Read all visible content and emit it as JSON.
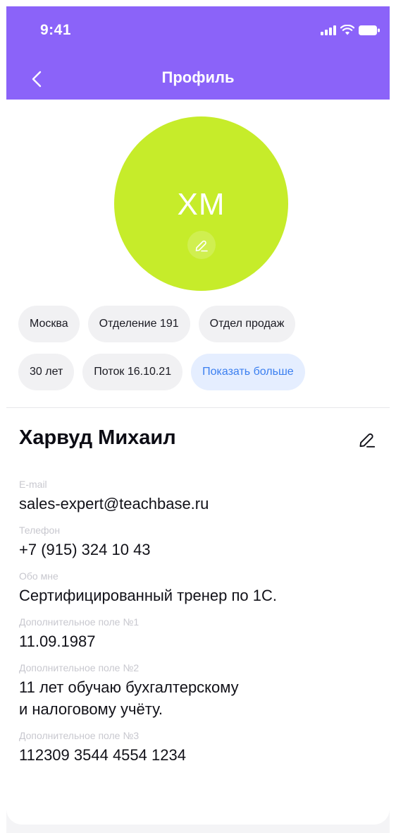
{
  "status_bar": {
    "time": "9:41"
  },
  "header": {
    "title": "Профиль"
  },
  "profile": {
    "initials": "ХМ",
    "name": "Харвуд Михаил"
  },
  "tags": {
    "row1": [
      "Москва",
      "Отделение 191",
      "Отдел продаж"
    ],
    "row2": [
      "30 лет",
      "Поток 16.10.21"
    ],
    "show_more": "Показать больше"
  },
  "fields": [
    {
      "label": "E-mail",
      "value": "sales-expert@teachbase.ru"
    },
    {
      "label": "Телефон",
      "value": "+7 (915) 324 10 43"
    },
    {
      "label": "Обо мне",
      "value": "Сертифицированный тренер по 1С."
    },
    {
      "label": "Дополнительное поле №1",
      "value": "11.09.1987"
    },
    {
      "label": "Дополнительное поле №2",
      "value": "11 лет обучаю бухгалтерскому\nи налоговому учёту."
    },
    {
      "label": "Дополнительное поле №3",
      "value": "112309 3544 4554 1234"
    }
  ],
  "colors": {
    "header": "#8b63f9",
    "avatar": "#c6ec2a",
    "link": "#3b7ff0"
  },
  "icons": [
    "signal-icon",
    "wifi-icon",
    "battery-icon",
    "back-chevron-icon",
    "edit-pencil-icon"
  ]
}
